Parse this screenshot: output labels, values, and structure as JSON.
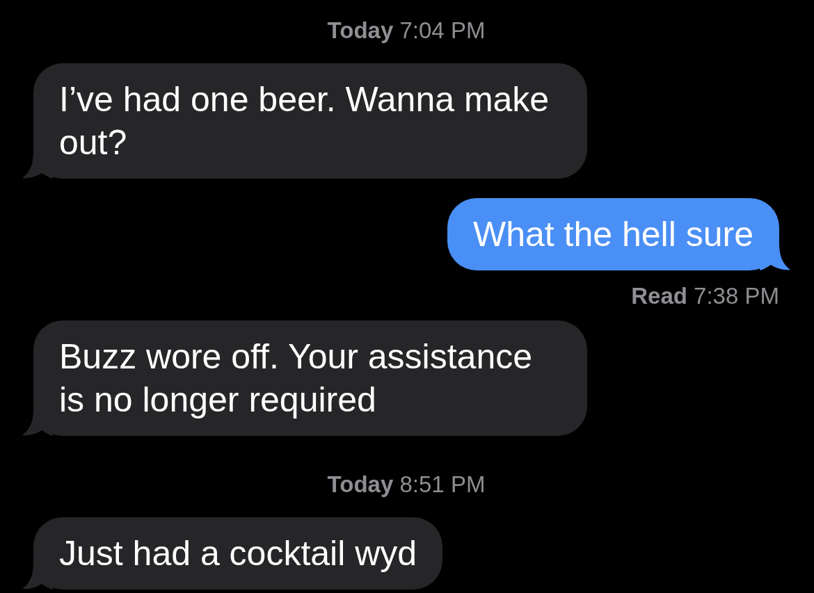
{
  "messages": [
    {
      "kind": "timestamp",
      "day": "Today",
      "time": "7:04 PM"
    },
    {
      "kind": "received",
      "text": "I’ve had one beer. Wanna make out?"
    },
    {
      "kind": "sent",
      "text": "What the hell sure"
    },
    {
      "kind": "receipt",
      "status": "Read",
      "time": "7:38 PM"
    },
    {
      "kind": "received",
      "text": "Buzz wore off. Your assistance is no longer required"
    },
    {
      "kind": "timestamp",
      "day": "Today",
      "time": "8:51 PM"
    },
    {
      "kind": "received",
      "text": "Just had a cocktail wyd"
    }
  ]
}
